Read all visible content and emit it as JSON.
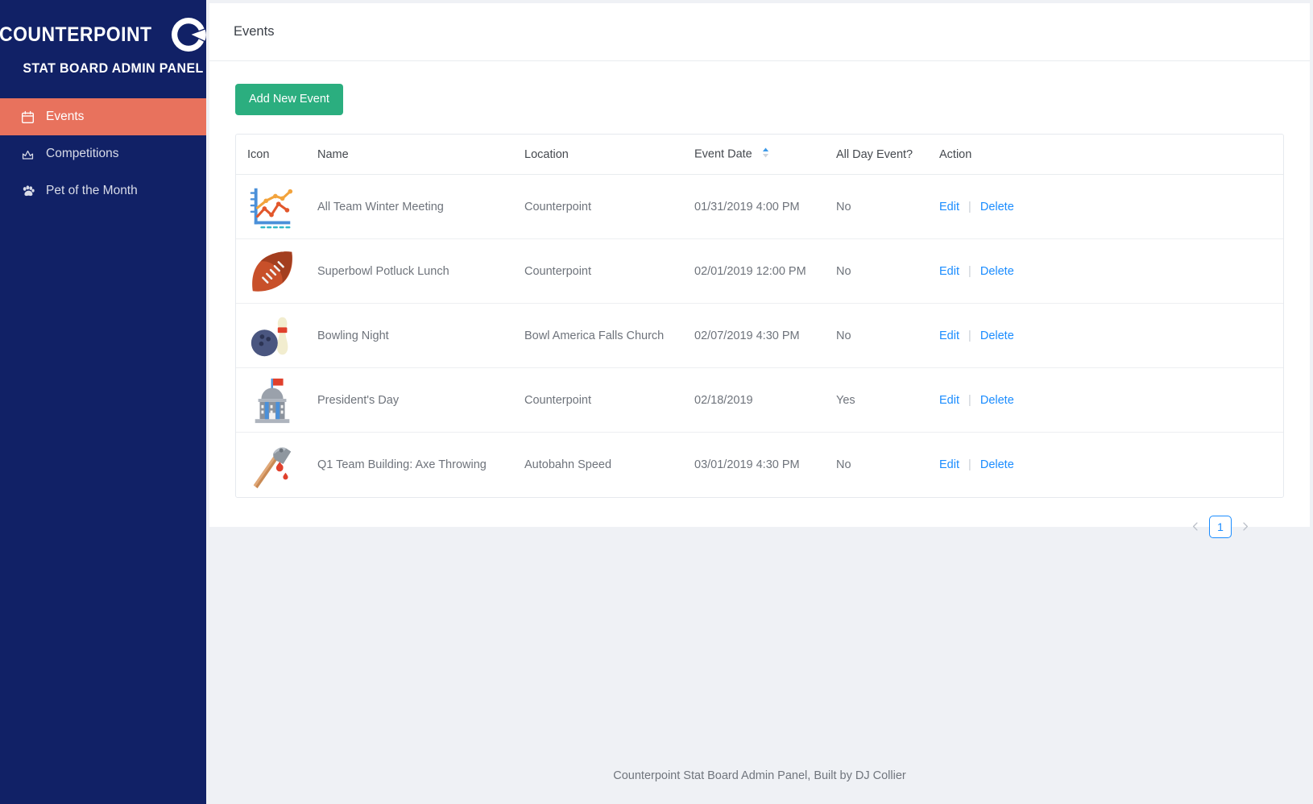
{
  "sidebar": {
    "brand_word": "COUNTERPOINT",
    "brand_mark_icon": "counterpoint-logo-icon",
    "brand_subtitle": "STAT BOARD ADMIN PANEL",
    "active_color": "#e8725d",
    "background_color": "#112166",
    "items": [
      {
        "label": "Events",
        "icon": "calendar-icon",
        "active": true
      },
      {
        "label": "Competitions",
        "icon": "crown-icon",
        "active": false
      },
      {
        "label": "Pet of the Month",
        "icon": "paw-icon",
        "active": false
      }
    ]
  },
  "header": {
    "title": "Events"
  },
  "toolbar": {
    "add_label": "Add New Event",
    "add_color": "#2bae7f"
  },
  "table": {
    "columns": [
      {
        "label": "Icon"
      },
      {
        "label": "Name"
      },
      {
        "label": "Location"
      },
      {
        "label": "Event Date",
        "sortable": true,
        "sort_direction": "asc"
      },
      {
        "label": "All Day Event?"
      },
      {
        "label": "Action"
      }
    ],
    "action_labels": {
      "edit": "Edit",
      "separator": "|",
      "delete": "Delete"
    },
    "link_color": "#1a8cff",
    "rows": [
      {
        "icon": "chart-increasing-icon",
        "name": "All Team Winter Meeting",
        "location": "Counterpoint",
        "event_date": "01/31/2019 4:00 PM",
        "all_day": "No"
      },
      {
        "icon": "football-icon",
        "name": "Superbowl Potluck Lunch",
        "location": "Counterpoint",
        "event_date": "02/01/2019 12:00 PM",
        "all_day": "No"
      },
      {
        "icon": "bowling-icon",
        "name": "Bowling Night",
        "location": "Bowl America Falls Church",
        "event_date": "02/07/2019 4:30 PM",
        "all_day": "No"
      },
      {
        "icon": "classical-building-icon",
        "name": "President's Day",
        "location": "Counterpoint",
        "event_date": "02/18/2019",
        "all_day": "Yes"
      },
      {
        "icon": "axe-icon",
        "name": "Q1 Team Building: Axe Throwing",
        "location": "Autobahn Speed",
        "event_date": "03/01/2019 4:30 PM",
        "all_day": "No"
      }
    ]
  },
  "pagination": {
    "prev_icon": "chevron-left-icon",
    "next_icon": "chevron-right-icon",
    "current_page": "1"
  },
  "footer": {
    "text": "Counterpoint Stat Board Admin Panel, Built by DJ Collier"
  }
}
